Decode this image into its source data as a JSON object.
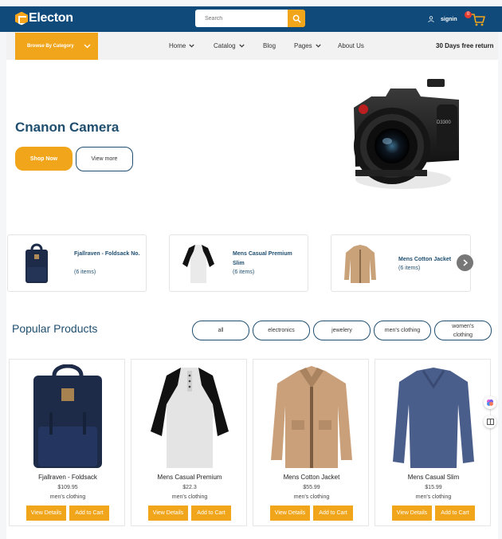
{
  "header": {
    "brand": "Electon",
    "search_placeholder": "Search",
    "signin_label": "signin",
    "cart_count": "0"
  },
  "nav": {
    "browse_label": "Browse By Category",
    "links": [
      "Home",
      "Catalog",
      "Blog",
      "Pages",
      "About Us"
    ],
    "promo": "30 Days free return"
  },
  "hero": {
    "title": "Cnanon Camera",
    "shop_button": "Shop Now",
    "more_button": "View more"
  },
  "categories": [
    {
      "name": "Fjallraven - Foldsack No.",
      "count": "(6 items)"
    },
    {
      "name": "Mens Casual Premium Slim",
      "count": "(6 items)"
    },
    {
      "name": "Mens Cotton Jacket",
      "count": "(6 items)"
    }
  ],
  "popular": {
    "title": "Popular Products",
    "filters": [
      "all",
      "electronics",
      "jewelery",
      "men's clothing",
      "women's clothing"
    ]
  },
  "products": [
    {
      "name": "Fjallraven - Foldsack",
      "price": "$109.95",
      "category": "men's clothing",
      "details_label": "View Details",
      "cart_label": "Add to Cart"
    },
    {
      "name": "Mens Casual Premium",
      "price": "$22.3",
      "category": "men's clothing",
      "details_label": "View Details",
      "cart_label": "Add to Cart"
    },
    {
      "name": "Mens Cotton Jacket",
      "price": "$55.99",
      "category": "men's clothing",
      "details_label": "View Details",
      "cart_label": "Add to Cart"
    },
    {
      "name": "Mens Casual Slim",
      "price": "$15.99",
      "category": "men's clothing",
      "details_label": "View Details",
      "cart_label": "Add to Cart"
    }
  ],
  "colors": {
    "brand_blue": "#0f4a7a",
    "accent_orange": "#f0a51a",
    "title_blue": "#1f4e6f"
  },
  "icons": [
    "logo-icon",
    "search-icon",
    "user-icon",
    "cart-icon",
    "chevron-down-icon",
    "chevron-right-icon"
  ]
}
